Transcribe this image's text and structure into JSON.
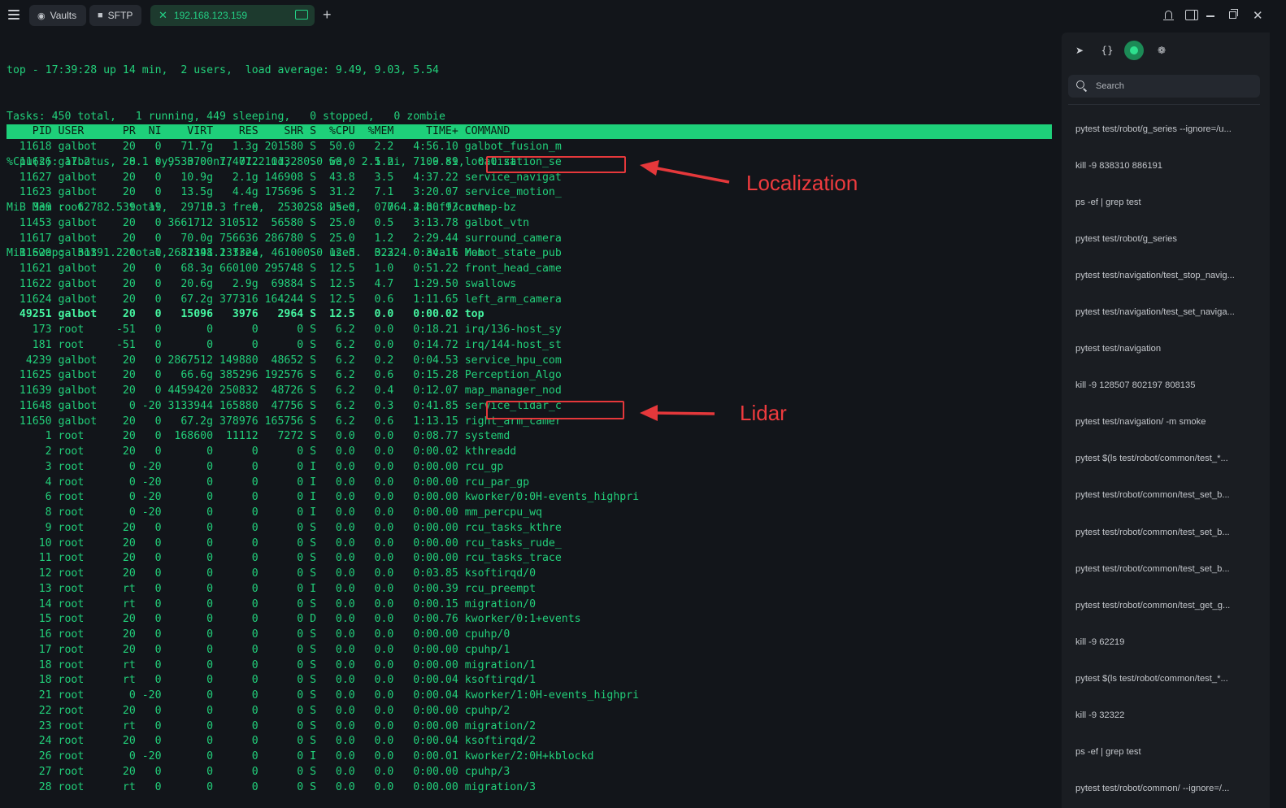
{
  "tabs": [
    {
      "label": "Vaults",
      "icon": "vault-icon"
    },
    {
      "label": "SFTP",
      "icon": "folder-icon"
    },
    {
      "label": "192.168.123.159",
      "icon": "close-icon",
      "active": true
    }
  ],
  "terminal": {
    "summary": [
      "top - 17:39:28 up 14 min,  2 users,  load average: 9.49, 9.03, 5.54",
      "Tasks: 450 total,   1 running, 449 sleeping,   0 stopped,   0 zombie",
      "%Cpu(s): 17.2 us,  8.1 sy,  0.0 ni, 71.2 id,  0.0 wa,  2.5 hi,  1.0 si,  0.0 st",
      "MiB Mem :  62782.5 total,  29715.3 free,  25302.8 used,   7764.4 buff/cache",
      "MiB Swap:  31391.2 total,  31391.2 free,      0.0 used.  32324.0 avail Mem"
    ],
    "columns": [
      "PID",
      "USER",
      "PR",
      "NI",
      "VIRT",
      "RES",
      "SHR",
      "S",
      "%CPU",
      "%MEM",
      "TIME+",
      "COMMAND"
    ],
    "processes": [
      [
        "11618",
        "galbot",
        "20",
        "0",
        "71.7g",
        "1.3g",
        "201580",
        "S",
        "50.0",
        "2.2",
        "4:56.10",
        "galbot_fusion_m"
      ],
      [
        "11626",
        "galbot",
        "20",
        "0",
        "9533700",
        "774072",
        "101328",
        "S",
        "50.0",
        "1.2",
        "7:09.89",
        "localization_se"
      ],
      [
        "11627",
        "galbot",
        "20",
        "0",
        "10.9g",
        "2.1g",
        "146908",
        "S",
        "43.8",
        "3.5",
        "4:37.22",
        "service_navigat"
      ],
      [
        "11623",
        "galbot",
        "20",
        "0",
        "13.5g",
        "4.4g",
        "175696",
        "S",
        "31.2",
        "7.1",
        "3:20.07",
        "service_motion_"
      ],
      [
        "339",
        "root",
        "39",
        "19",
        "0",
        "0",
        "0",
        "S",
        "25.0",
        "0.0",
        "2:30.93",
        "nvmap-bz"
      ],
      [
        "11453",
        "galbot",
        "20",
        "0",
        "3661712",
        "310512",
        "56580",
        "S",
        "25.0",
        "0.5",
        "3:13.78",
        "galbot_vtn"
      ],
      [
        "11617",
        "galbot",
        "20",
        "0",
        "70.0g",
        "756636",
        "286780",
        "S",
        "25.0",
        "1.2",
        "2:29.44",
        "surround_camera"
      ],
      [
        "11620",
        "galbot",
        "20",
        "0",
        "2682148",
        "133324",
        "46100",
        "S",
        "12.5",
        "0.2",
        "0:34.16",
        "robot_state_pub"
      ],
      [
        "11621",
        "galbot",
        "20",
        "0",
        "68.3g",
        "660100",
        "295748",
        "S",
        "12.5",
        "1.0",
        "0:51.22",
        "front_head_came"
      ],
      [
        "11622",
        "galbot",
        "20",
        "0",
        "20.6g",
        "2.9g",
        "69884",
        "S",
        "12.5",
        "4.7",
        "1:29.50",
        "swallows"
      ],
      [
        "11624",
        "galbot",
        "20",
        "0",
        "67.2g",
        "377316",
        "164244",
        "S",
        "12.5",
        "0.6",
        "1:11.65",
        "left_arm_camera"
      ],
      [
        "49251",
        "galbot",
        "20",
        "0",
        "15096",
        "3976",
        "2964",
        "S",
        "12.5",
        "0.0",
        "0:00.02",
        "top"
      ],
      [
        "173",
        "root",
        "-51",
        "0",
        "0",
        "0",
        "0",
        "S",
        "6.2",
        "0.0",
        "0:18.21",
        "irq/136-host_sy"
      ],
      [
        "181",
        "root",
        "-51",
        "0",
        "0",
        "0",
        "0",
        "S",
        "6.2",
        "0.0",
        "0:14.72",
        "irq/144-host_st"
      ],
      [
        "4239",
        "galbot",
        "20",
        "0",
        "2867512",
        "149880",
        "48652",
        "S",
        "6.2",
        "0.2",
        "0:04.53",
        "service_hpu_com"
      ],
      [
        "11625",
        "galbot",
        "20",
        "0",
        "66.6g",
        "385296",
        "192576",
        "S",
        "6.2",
        "0.6",
        "0:15.28",
        "Perception_Algo"
      ],
      [
        "11639",
        "galbot",
        "20",
        "0",
        "4459420",
        "250832",
        "48726",
        "S",
        "6.2",
        "0.4",
        "0:12.07",
        "map_manager_nod"
      ],
      [
        "11648",
        "galbot",
        "0",
        "-20",
        "3133944",
        "165880",
        "47756",
        "S",
        "6.2",
        "0.3",
        "0:41.85",
        "service_lidar_c"
      ],
      [
        "11650",
        "galbot",
        "20",
        "0",
        "67.2g",
        "378976",
        "165756",
        "S",
        "6.2",
        "0.6",
        "1:13.15",
        "right_arm_camer"
      ],
      [
        "1",
        "root",
        "20",
        "0",
        "168600",
        "11112",
        "7272",
        "S",
        "0.0",
        "0.0",
        "0:08.77",
        "systemd"
      ],
      [
        "2",
        "root",
        "20",
        "0",
        "0",
        "0",
        "0",
        "S",
        "0.0",
        "0.0",
        "0:00.02",
        "kthreadd"
      ],
      [
        "3",
        "root",
        "0",
        "-20",
        "0",
        "0",
        "0",
        "I",
        "0.0",
        "0.0",
        "0:00.00",
        "rcu_gp"
      ],
      [
        "4",
        "root",
        "0",
        "-20",
        "0",
        "0",
        "0",
        "I",
        "0.0",
        "0.0",
        "0:00.00",
        "rcu_par_gp"
      ],
      [
        "6",
        "root",
        "0",
        "-20",
        "0",
        "0",
        "0",
        "I",
        "0.0",
        "0.0",
        "0:00.00",
        "kworker/0:0H-events_highpri"
      ],
      [
        "8",
        "root",
        "0",
        "-20",
        "0",
        "0",
        "0",
        "I",
        "0.0",
        "0.0",
        "0:00.00",
        "mm_percpu_wq"
      ],
      [
        "9",
        "root",
        "20",
        "0",
        "0",
        "0",
        "0",
        "S",
        "0.0",
        "0.0",
        "0:00.00",
        "rcu_tasks_kthre"
      ],
      [
        "10",
        "root",
        "20",
        "0",
        "0",
        "0",
        "0",
        "S",
        "0.0",
        "0.0",
        "0:00.00",
        "rcu_tasks_rude_"
      ],
      [
        "11",
        "root",
        "20",
        "0",
        "0",
        "0",
        "0",
        "S",
        "0.0",
        "0.0",
        "0:00.00",
        "rcu_tasks_trace"
      ],
      [
        "12",
        "root",
        "20",
        "0",
        "0",
        "0",
        "0",
        "S",
        "0.0",
        "0.0",
        "0:03.85",
        "ksoftirqd/0"
      ],
      [
        "13",
        "root",
        "rt",
        "0",
        "0",
        "0",
        "0",
        "I",
        "0.0",
        "0.0",
        "0:00.39",
        "rcu_preempt"
      ],
      [
        "14",
        "root",
        "rt",
        "0",
        "0",
        "0",
        "0",
        "S",
        "0.0",
        "0.0",
        "0:00.15",
        "migration/0"
      ],
      [
        "15",
        "root",
        "20",
        "0",
        "0",
        "0",
        "0",
        "D",
        "0.0",
        "0.0",
        "0:00.76",
        "kworker/0:1+events"
      ],
      [
        "16",
        "root",
        "20",
        "0",
        "0",
        "0",
        "0",
        "S",
        "0.0",
        "0.0",
        "0:00.00",
        "cpuhp/0"
      ],
      [
        "17",
        "root",
        "20",
        "0",
        "0",
        "0",
        "0",
        "S",
        "0.0",
        "0.0",
        "0:00.00",
        "cpuhp/1"
      ],
      [
        "18",
        "root",
        "rt",
        "0",
        "0",
        "0",
        "0",
        "S",
        "0.0",
        "0.0",
        "0:00.00",
        "migration/1"
      ],
      [
        "18",
        "root",
        "rt",
        "0",
        "0",
        "0",
        "0",
        "S",
        "0.0",
        "0.0",
        "0:00.04",
        "ksoftirqd/1"
      ],
      [
        "21",
        "root",
        "0",
        "-20",
        "0",
        "0",
        "0",
        "S",
        "0.0",
        "0.0",
        "0:00.04",
        "kworker/1:0H-events_highpri"
      ],
      [
        "22",
        "root",
        "20",
        "0",
        "0",
        "0",
        "0",
        "S",
        "0.0",
        "0.0",
        "0:00.00",
        "cpuhp/2"
      ],
      [
        "23",
        "root",
        "rt",
        "0",
        "0",
        "0",
        "0",
        "S",
        "0.0",
        "0.0",
        "0:00.00",
        "migration/2"
      ],
      [
        "24",
        "root",
        "20",
        "0",
        "0",
        "0",
        "0",
        "S",
        "0.0",
        "0.0",
        "0:00.04",
        "ksoftirqd/2"
      ],
      [
        "26",
        "root",
        "0",
        "-20",
        "0",
        "0",
        "0",
        "I",
        "0.0",
        "0.0",
        "0:00.01",
        "kworker/2:0H+kblockd"
      ],
      [
        "27",
        "root",
        "20",
        "0",
        "0",
        "0",
        "0",
        "S",
        "0.0",
        "0.0",
        "0:00.00",
        "cpuhp/3"
      ],
      [
        "28",
        "root",
        "rt",
        "0",
        "0",
        "0",
        "0",
        "S",
        "0.0",
        "0.0",
        "0:00.00",
        "migration/3"
      ]
    ],
    "bold_rows": [
      11
    ],
    "annotations": {
      "localization": "Localization",
      "lidar": "Lidar"
    }
  },
  "sidebar": {
    "tools": [
      "rocket-icon",
      "braces-icon",
      "active-dot-icon",
      "palette-icon"
    ],
    "search_placeholder": "Search",
    "history": [
      "pytest test/robot/g_series --ignore=/u...",
      "kill -9 838310 886191",
      "ps -ef | grep test",
      "pytest test/robot/g_series",
      "pytest test/navigation/test_stop_navig...",
      "pytest test/navigation/test_set_naviga...",
      "pytest test/navigation",
      "kill -9 128507 802197 808135",
      "pytest test/navigation/ -m smoke",
      "pytest $(ls test/robot/common/test_*...",
      "pytest test/robot/common/test_set_b...",
      "pytest test/robot/common/test_set_b...",
      "pytest test/robot/common/test_set_b...",
      "pytest test/robot/common/test_get_g...",
      "kill -9 62219",
      "pytest $(ls test/robot/common/test_*...",
      "kill -9 32322",
      "ps -ef | grep test",
      "pytest test/robot/common/ --ignore=/..."
    ]
  },
  "colors": {
    "accent": "#22cf7a",
    "header_bar": "#1ed07a",
    "annotation": "#e5383b",
    "background": "#12151a"
  }
}
